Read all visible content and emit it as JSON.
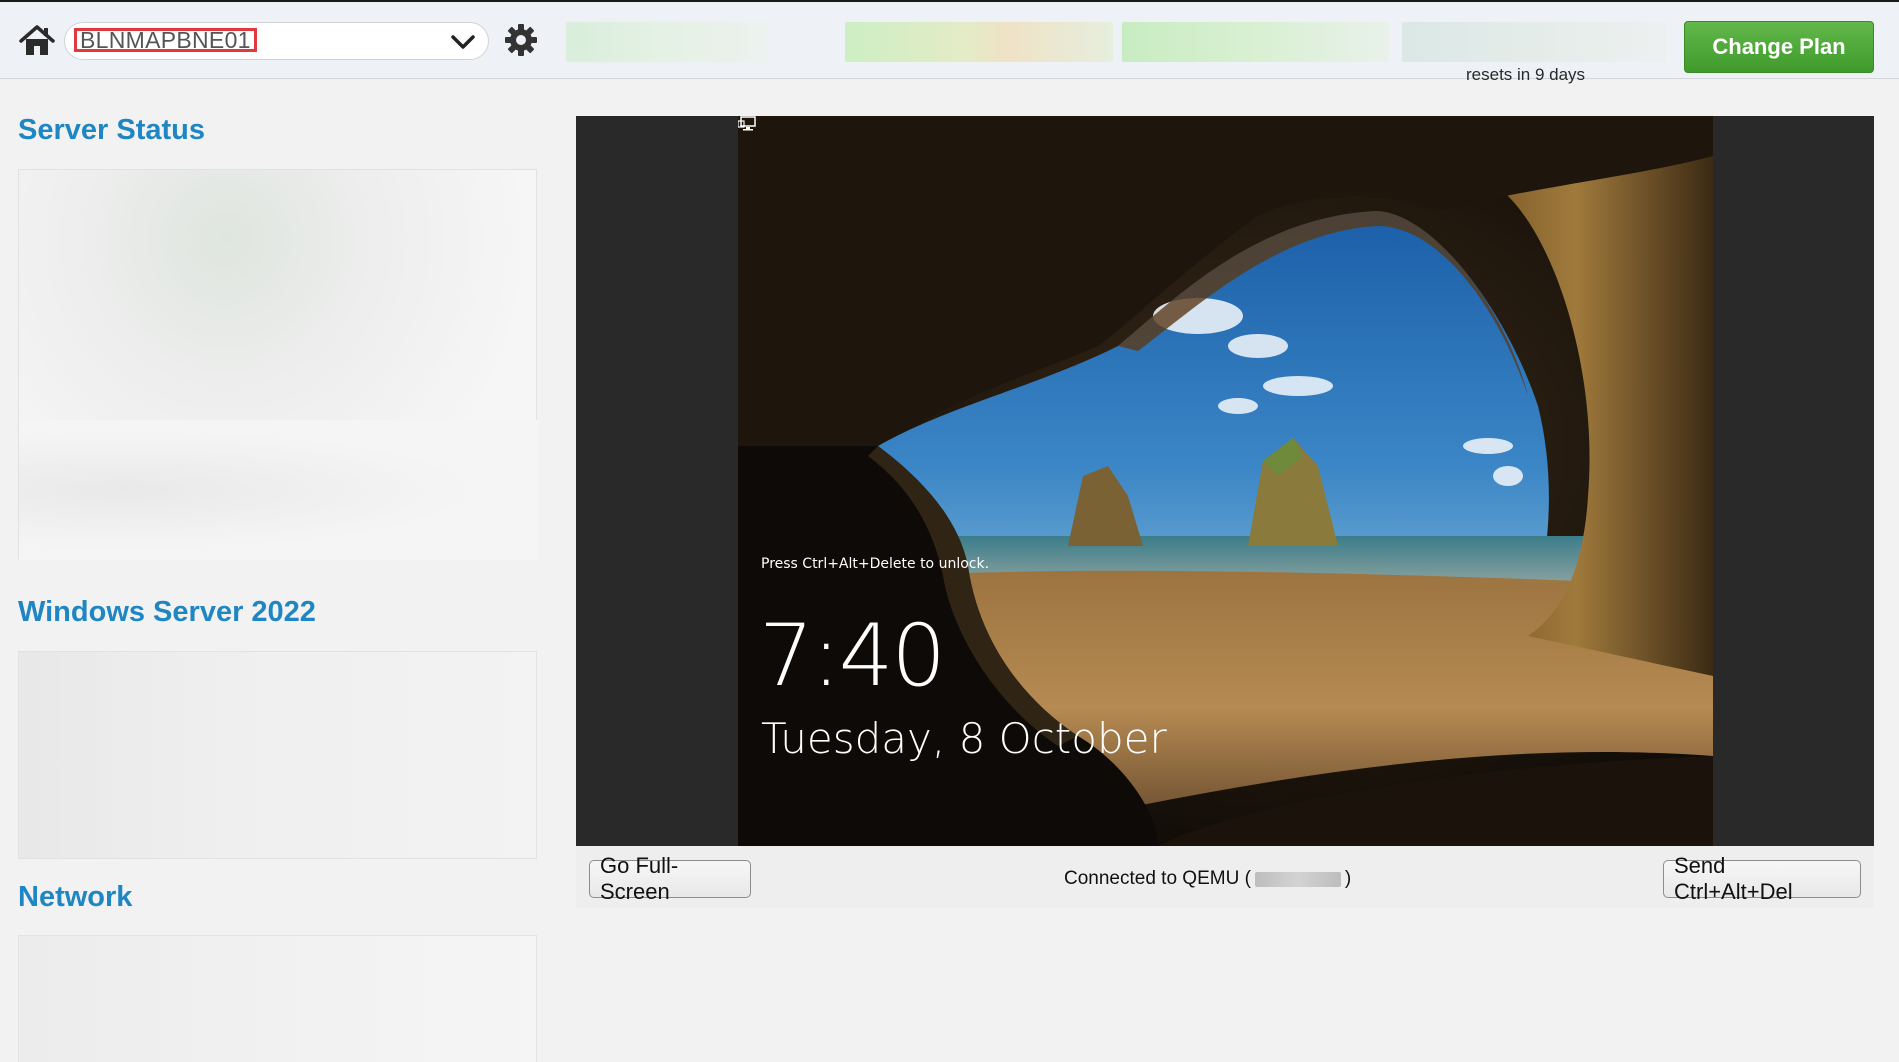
{
  "topbar": {
    "home_icon": "home-icon",
    "server_name": "BLNMAPBNE01",
    "dropdown_icon": "chevron-down-icon",
    "settings_icon": "gear-icon",
    "usage_note": "resets in 9 days",
    "change_plan_label": "Change Plan",
    "change_plan_color": "#4caa36"
  },
  "sidebar": {
    "sections": [
      {
        "title": "Server Status"
      },
      {
        "title": "Windows Server 2022"
      },
      {
        "title": "Network"
      }
    ],
    "title_color": "#1f86c4"
  },
  "console": {
    "lock_hint": "Press Ctrl+Alt+Delete to unlock.",
    "time": "7:40",
    "date": "Tuesday, 8 October",
    "network_icon": "monitor-icon",
    "fullscreen_label": "Go Full-Screen",
    "status_prefix": "Connected to QEMU (",
    "status_suffix": ")",
    "cad_label": "Send Ctrl+Alt+Del"
  }
}
